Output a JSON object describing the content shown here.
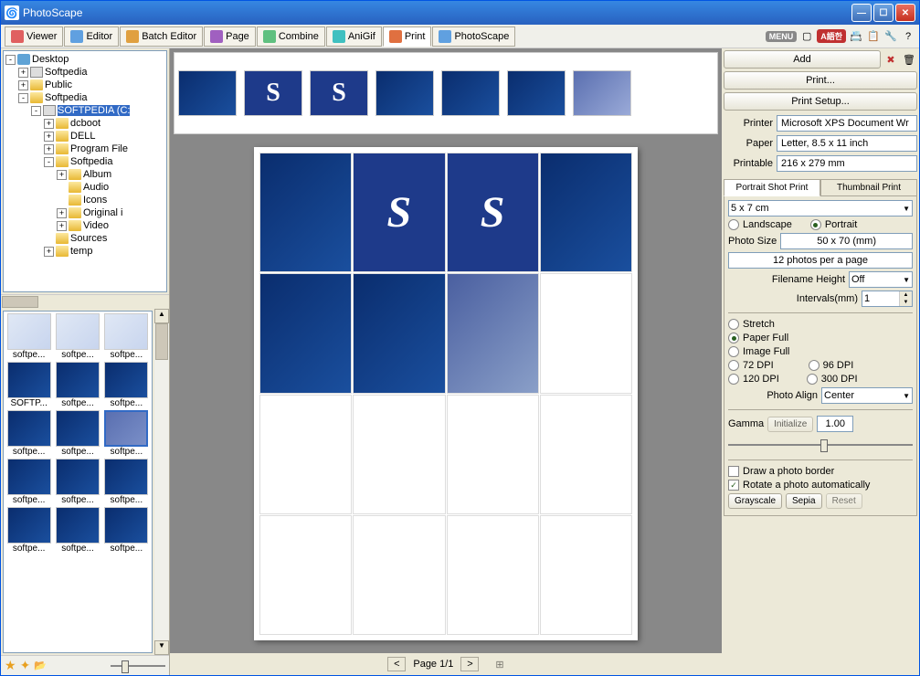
{
  "window": {
    "title": "PhotoScape"
  },
  "tabs": [
    {
      "label": "Viewer"
    },
    {
      "label": "Editor"
    },
    {
      "label": "Batch Editor"
    },
    {
      "label": "Page"
    },
    {
      "label": "Combine"
    },
    {
      "label": "AniGif"
    },
    {
      "label": "Print"
    },
    {
      "label": "PhotoScape"
    }
  ],
  "menu_badge": "MENU",
  "lang_badge": "A語한",
  "tree": {
    "root": "Desktop",
    "nodes": [
      {
        "label": "Softpedia",
        "depth": 1,
        "icon": "drive",
        "toggle": "+"
      },
      {
        "label": "Public",
        "depth": 1,
        "icon": "folder",
        "toggle": "+"
      },
      {
        "label": "Softpedia",
        "depth": 1,
        "icon": "folder",
        "toggle": "-"
      },
      {
        "label": "SOFTPEDIA (C:",
        "depth": 2,
        "icon": "drive",
        "toggle": "-",
        "selected": true
      },
      {
        "label": "dcboot",
        "depth": 3,
        "icon": "folder",
        "toggle": "+"
      },
      {
        "label": "DELL",
        "depth": 3,
        "icon": "folder",
        "toggle": "+"
      },
      {
        "label": "Program File",
        "depth": 3,
        "icon": "folder",
        "toggle": "+"
      },
      {
        "label": "Softpedia",
        "depth": 3,
        "icon": "folder",
        "toggle": "-"
      },
      {
        "label": "Album",
        "depth": 4,
        "icon": "folder",
        "toggle": "+"
      },
      {
        "label": "Audio",
        "depth": 4,
        "icon": "folder",
        "toggle": ""
      },
      {
        "label": "Icons",
        "depth": 4,
        "icon": "folder",
        "toggle": ""
      },
      {
        "label": "Original i",
        "depth": 4,
        "icon": "folder",
        "toggle": "+"
      },
      {
        "label": "Video",
        "depth": 4,
        "icon": "folder",
        "toggle": "+"
      },
      {
        "label": "Sources",
        "depth": 3,
        "icon": "folder",
        "toggle": ""
      },
      {
        "label": "temp",
        "depth": 3,
        "icon": "folder",
        "toggle": "+"
      }
    ]
  },
  "thumbs": [
    {
      "label": "softpe...",
      "style": "light"
    },
    {
      "label": "softpe...",
      "style": "light"
    },
    {
      "label": "softpe...",
      "style": "light"
    },
    {
      "label": "SOFTP...",
      "style": "swirl"
    },
    {
      "label": "softpe...",
      "style": "swirl"
    },
    {
      "label": "softpe...",
      "style": "swirl"
    },
    {
      "label": "softpe...",
      "style": "swirl"
    },
    {
      "label": "softpe...",
      "style": "swirl"
    },
    {
      "label": "softpe...",
      "style": "faded",
      "selected": true
    },
    {
      "label": "softpe...",
      "style": "swirl"
    },
    {
      "label": "softpe...",
      "style": "swirl"
    },
    {
      "label": "softpe...",
      "style": "swirl"
    },
    {
      "label": "softpe...",
      "style": "swirl"
    },
    {
      "label": "softpe...",
      "style": "swirl"
    },
    {
      "label": "softpe...",
      "style": "swirl"
    }
  ],
  "filmstrip": [
    {
      "style": "swirl"
    },
    {
      "style": "s",
      "letter": "S"
    },
    {
      "style": "s",
      "letter": "S"
    },
    {
      "style": "swirl"
    },
    {
      "style": "swirl"
    },
    {
      "style": "swirl"
    },
    {
      "style": "faded"
    }
  ],
  "page_nav": {
    "prev": "<",
    "label": "Page 1/1",
    "next": ">"
  },
  "actions": {
    "add": "Add",
    "print": "Print...",
    "print_setup": "Print Setup..."
  },
  "printer_info": {
    "printer_label": "Printer",
    "printer_val": "Microsoft XPS Document Wr",
    "paper_label": "Paper",
    "paper_val": "Letter, 8.5 x 11 inch",
    "printable_label": "Printable",
    "printable_val": "216 x 279 mm"
  },
  "prop_tabs": {
    "portrait": "Portrait Shot Print",
    "thumbnail": "Thumbnail Print"
  },
  "settings": {
    "size_select": "5 x 7 cm",
    "landscape": "Landscape",
    "portrait": "Portrait",
    "photo_size_label": "Photo Size",
    "photo_size_val": "50 x 70 (mm)",
    "per_page": "12 photos per a page",
    "filename_height_label": "Filename Height",
    "filename_height_val": "Off",
    "intervals_label": "Intervals(mm)",
    "intervals_val": "1",
    "stretch": "Stretch",
    "paper_full": "Paper Full",
    "image_full": "Image Full",
    "dpi72": "72 DPI",
    "dpi96": "96 DPI",
    "dpi120": "120 DPI",
    "dpi300": "300 DPI",
    "photo_align_label": "Photo Align",
    "photo_align_val": "Center",
    "gamma_label": "Gamma",
    "initialize": "Initialize",
    "gamma_val": "1.00",
    "draw_border": "Draw a photo border",
    "rotate_auto": "Rotate a photo automatically",
    "grayscale": "Grayscale",
    "sepia": "Sepia",
    "reset": "Reset"
  }
}
